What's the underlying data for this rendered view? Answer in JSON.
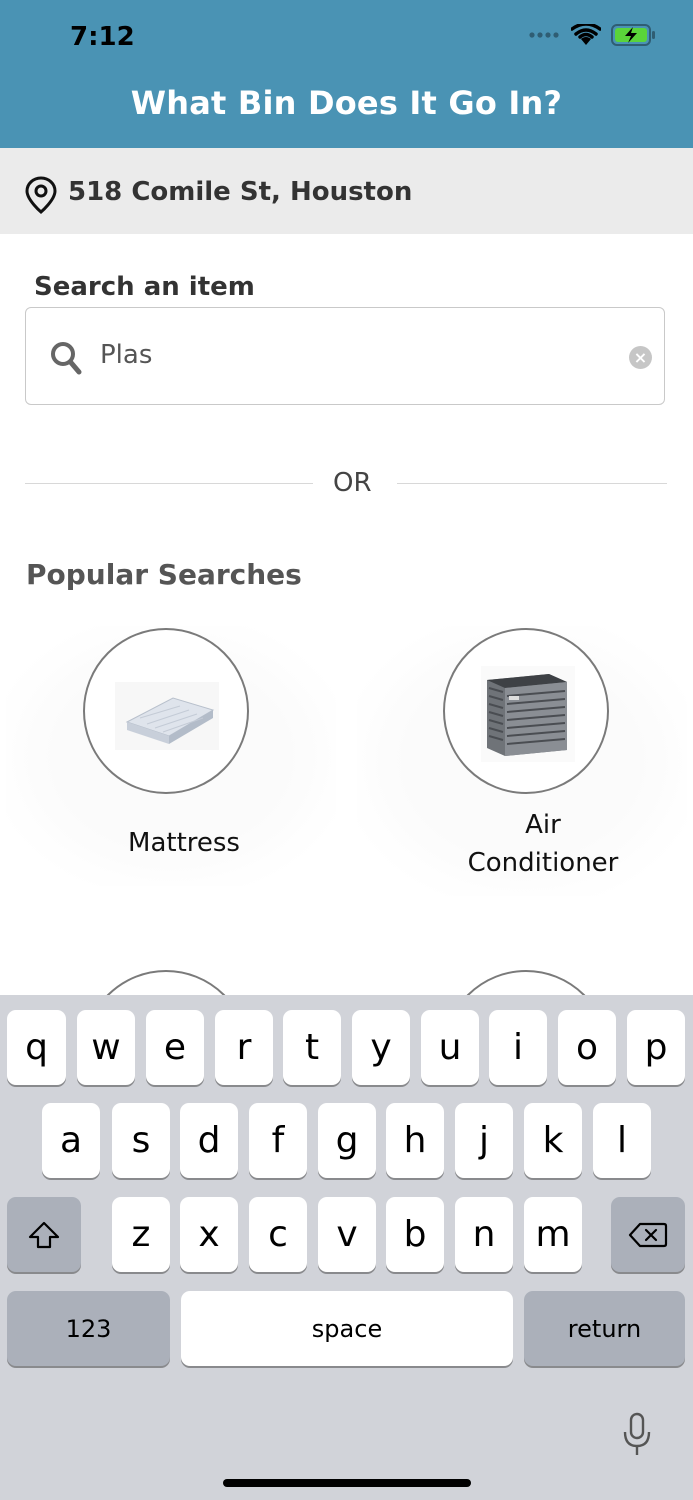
{
  "status": {
    "time": "7:12"
  },
  "header": {
    "title": "What Bin Does It Go In?"
  },
  "location": {
    "address": "518 Comile St, Houston"
  },
  "search": {
    "label": "Search an item",
    "value": "Plas",
    "clear": "×"
  },
  "divider": {
    "text": "OR"
  },
  "popular": {
    "title": "Popular Searches",
    "items": [
      {
        "label": "Mattress",
        "icon": "mattress-image"
      },
      {
        "label": "Air Conditioner",
        "label_line1": "Air",
        "label_line2": "Conditioner",
        "icon": "air-conditioner-image"
      }
    ]
  },
  "keyboard": {
    "row1": [
      "q",
      "w",
      "e",
      "r",
      "t",
      "y",
      "u",
      "i",
      "o",
      "p"
    ],
    "row2": [
      "a",
      "s",
      "d",
      "f",
      "g",
      "h",
      "j",
      "k",
      "l"
    ],
    "row3": [
      "z",
      "x",
      "c",
      "v",
      "b",
      "n",
      "m"
    ],
    "numbers": "123",
    "space": "space",
    "return": "return"
  },
  "colors": {
    "header": "#4a93b4",
    "location_bar": "#ebebeb",
    "keyboard_bg": "#d1d3d9"
  }
}
